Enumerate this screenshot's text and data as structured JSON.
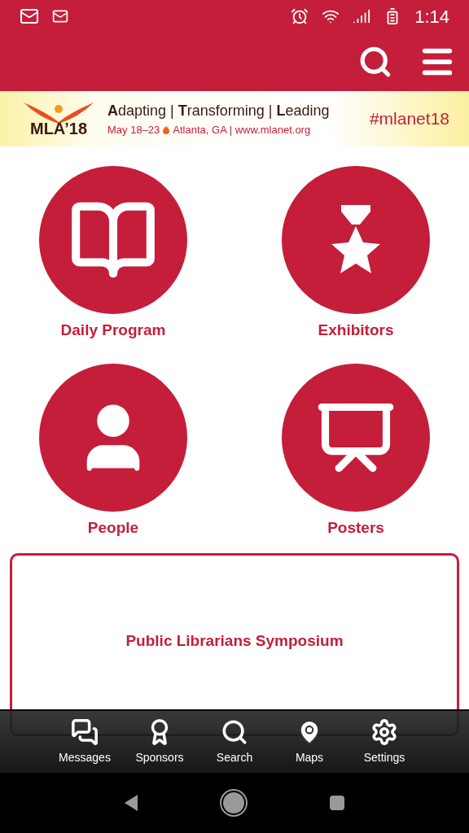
{
  "status_bar": {
    "time": "1:14"
  },
  "banner": {
    "logo": "MLA’18",
    "tagline": "**A**dapting | **T**ransforming | **L**eading",
    "dates": "May 18–23",
    "details": "Atlanta, GA | www.mlanet.org",
    "hashtag": "#mlanet18"
  },
  "tiles": [
    {
      "kind": "book",
      "label": "Daily Program"
    },
    {
      "kind": "star",
      "label": "Exhibitors"
    },
    {
      "kind": "person",
      "label": "People"
    },
    {
      "kind": "poster",
      "label": "Posters"
    }
  ],
  "card": {
    "title": "Public Librarians Symposium"
  },
  "bottom_nav": [
    {
      "kind": "messages",
      "label": "Messages"
    },
    {
      "kind": "sponsors",
      "label": "Sponsors"
    },
    {
      "kind": "search",
      "label": "Search"
    },
    {
      "kind": "maps",
      "label": "Maps"
    },
    {
      "kind": "settings",
      "label": "Settings"
    }
  ]
}
